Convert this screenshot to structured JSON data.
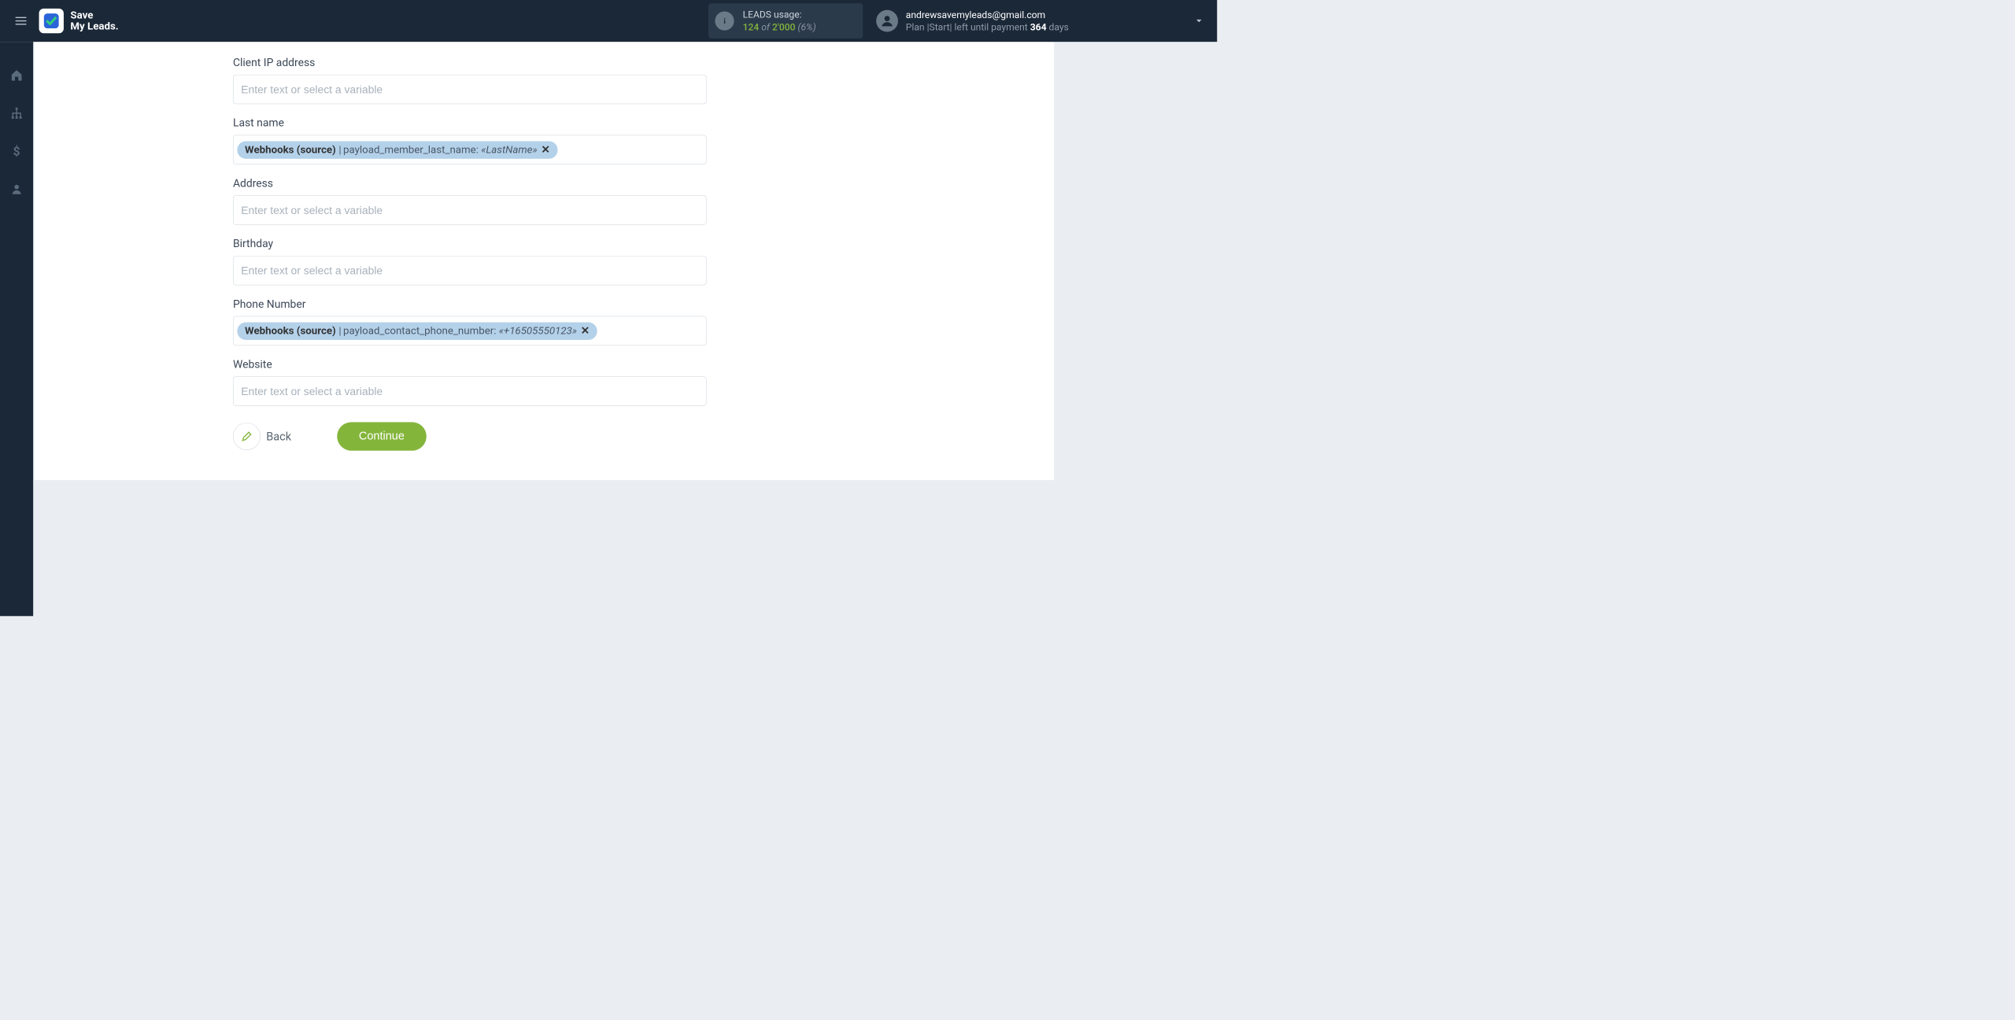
{
  "header": {
    "logo_line1": "Save",
    "logo_line2": "My Leads.",
    "usage": {
      "label": "LEADS usage:",
      "used": "124",
      "of_word": "of",
      "total": "2'000",
      "pct": "(6%)"
    },
    "account": {
      "email": "andrewsavemyleads@gmail.com",
      "plan_prefix": "Plan |Start| left until payment ",
      "days_num": "364",
      "days_suffix": " days"
    }
  },
  "fields": [
    {
      "key": "client_ip",
      "label": "Client IP address",
      "type": "text",
      "placeholder": "Enter text or select a variable"
    },
    {
      "key": "last_name",
      "label": "Last name",
      "type": "chip",
      "chip": {
        "source": "Webhooks (source)",
        "field": "payload_member_last_name:",
        "value": "«LastName»"
      }
    },
    {
      "key": "address",
      "label": "Address",
      "type": "text",
      "placeholder": "Enter text or select a variable"
    },
    {
      "key": "birthday",
      "label": "Birthday",
      "type": "text",
      "placeholder": "Enter text or select a variable"
    },
    {
      "key": "phone",
      "label": "Phone Number",
      "type": "chip",
      "chip": {
        "source": "Webhooks (source)",
        "field": "payload_contact_phone_number:",
        "value": "«+16505550123»"
      }
    },
    {
      "key": "website",
      "label": "Website",
      "type": "text",
      "placeholder": "Enter text or select a variable"
    }
  ],
  "actions": {
    "back": "Back",
    "continue": "Continue"
  }
}
